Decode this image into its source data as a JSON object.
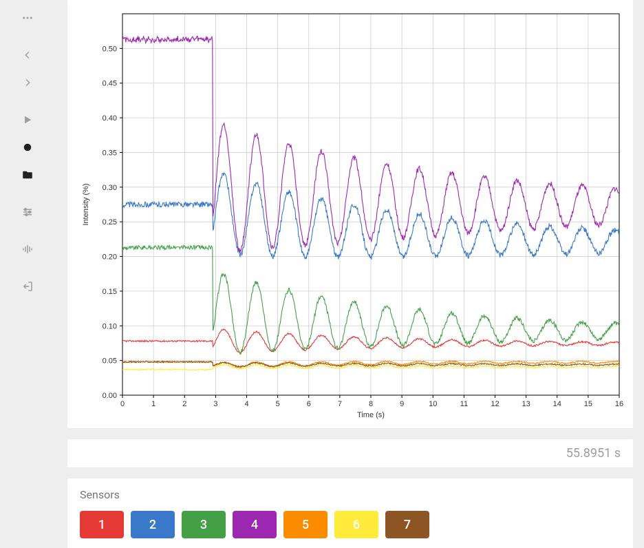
{
  "sidebar": {
    "items": [
      {
        "name": "dots-icon",
        "dark": false
      },
      {
        "name": "chevron-left-icon",
        "dark": false
      },
      {
        "name": "chevron-right-icon",
        "dark": false
      },
      {
        "name": "play-icon",
        "dark": false
      },
      {
        "name": "record-icon",
        "dark": true
      },
      {
        "name": "folder-icon",
        "dark": true
      },
      {
        "name": "sliders-icon",
        "dark": false
      },
      {
        "name": "wave-icon",
        "dark": false
      },
      {
        "name": "exit-icon",
        "dark": false
      }
    ]
  },
  "chart_data": {
    "type": "line",
    "xlabel": "Time (s)",
    "ylabel": "Intensity (%)",
    "xlim": [
      0,
      16
    ],
    "ylim": [
      0.0,
      0.55
    ],
    "xticks": [
      0,
      1,
      2,
      3,
      4,
      5,
      6,
      7,
      8,
      9,
      10,
      11,
      12,
      13,
      14,
      15,
      16
    ],
    "yticks": [
      0.0,
      0.05,
      0.1,
      0.15,
      0.2,
      0.25,
      0.3,
      0.35,
      0.4,
      0.45,
      0.5
    ],
    "series": [
      {
        "name": "1",
        "color": "#e53935",
        "flat": 0.078,
        "drop_to": 0.078,
        "amp0": 0.018,
        "decay": 0.16,
        "final": 0.074,
        "noise": 0.0012
      },
      {
        "name": "2",
        "color": "#3a79c9",
        "flat": 0.275,
        "drop_to": 0.265,
        "amp0": 0.06,
        "decay": 0.1,
        "final": 0.218,
        "noise": 0.004
      },
      {
        "name": "3",
        "color": "#43a047",
        "flat": 0.213,
        "drop_to": 0.12,
        "amp0": 0.06,
        "decay": 0.13,
        "final": 0.09,
        "noise": 0.003
      },
      {
        "name": "4",
        "color": "#9c27b0",
        "flat": 0.513,
        "drop_to": 0.3,
        "amp0": 0.095,
        "decay": 0.1,
        "final": 0.27,
        "noise": 0.004
      },
      {
        "name": "5",
        "color": "#fb8c00",
        "flat": 0.048,
        "drop_to": 0.043,
        "amp0": 0.004,
        "decay": 0.1,
        "final": 0.048,
        "noise": 0.001
      },
      {
        "name": "6",
        "color": "#ffeb3b",
        "flat": 0.037,
        "drop_to": 0.041,
        "amp0": 0.003,
        "decay": 0.1,
        "final": 0.041,
        "noise": 0.001
      },
      {
        "name": "7",
        "color": "#8d5524",
        "flat": 0.048,
        "drop_to": 0.044,
        "amp0": 0.003,
        "decay": 0.1,
        "final": 0.044,
        "noise": 0.001
      }
    ],
    "transition_x": 2.9,
    "period": 1.05
  },
  "time_card": {
    "value": "55.8951 s"
  },
  "sensors": {
    "title": "Sensors",
    "items": [
      {
        "label": "1",
        "color": "#e53935"
      },
      {
        "label": "2",
        "color": "#3a79c9"
      },
      {
        "label": "3",
        "color": "#43a047"
      },
      {
        "label": "4",
        "color": "#9c27b0"
      },
      {
        "label": "5",
        "color": "#fb8c00"
      },
      {
        "label": "6",
        "color": "#ffeb3b"
      },
      {
        "label": "7",
        "color": "#8d5524"
      }
    ]
  }
}
